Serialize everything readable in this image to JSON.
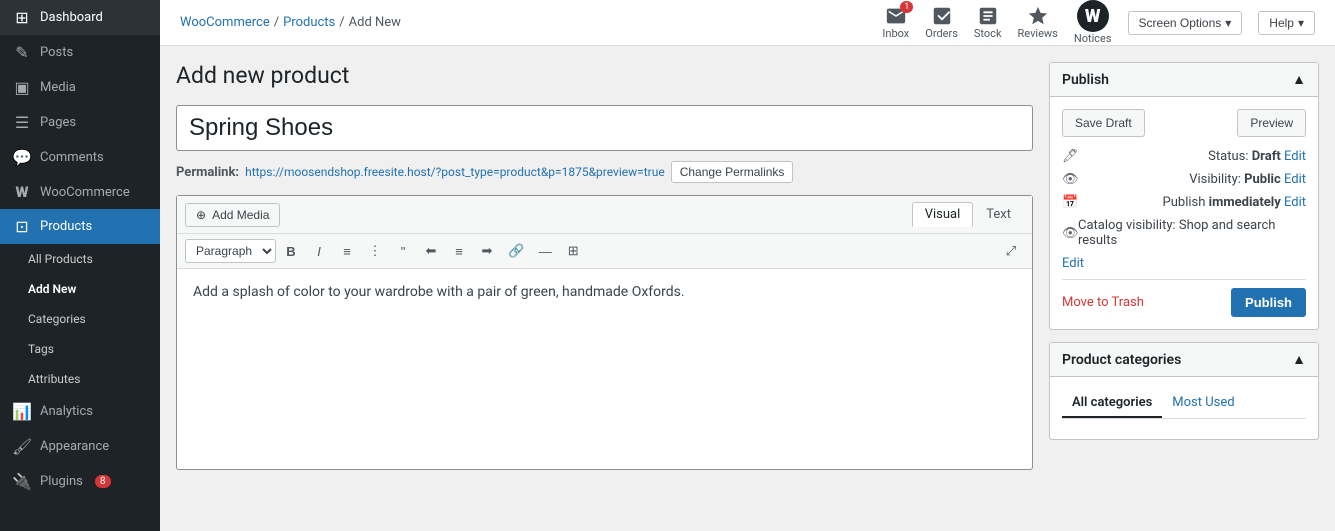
{
  "sidebar": {
    "items": [
      {
        "id": "dashboard",
        "label": "Dashboard",
        "icon": "⊞",
        "active": false
      },
      {
        "id": "posts",
        "label": "Posts",
        "icon": "✎",
        "active": false
      },
      {
        "id": "media",
        "label": "Media",
        "icon": "▣",
        "active": false
      },
      {
        "id": "pages",
        "label": "Pages",
        "icon": "☰",
        "active": false
      },
      {
        "id": "comments",
        "label": "Comments",
        "icon": "💬",
        "active": false
      },
      {
        "id": "woocommerce",
        "label": "WooCommerce",
        "icon": "W",
        "active": false
      },
      {
        "id": "products",
        "label": "Products",
        "icon": "⊡",
        "active": true
      },
      {
        "id": "all-products",
        "label": "All Products",
        "icon": "",
        "active": false,
        "sub": true
      },
      {
        "id": "add-new",
        "label": "Add New",
        "icon": "",
        "active": true,
        "sub": true
      },
      {
        "id": "categories",
        "label": "Categories",
        "icon": "",
        "active": false,
        "sub": true
      },
      {
        "id": "tags",
        "label": "Tags",
        "icon": "",
        "active": false,
        "sub": true
      },
      {
        "id": "attributes",
        "label": "Attributes",
        "icon": "",
        "active": false,
        "sub": true
      },
      {
        "id": "analytics",
        "label": "Analytics",
        "icon": "📊",
        "active": false
      },
      {
        "id": "appearance",
        "label": "Appearance",
        "icon": "🖌",
        "active": false
      },
      {
        "id": "plugins",
        "label": "Plugins",
        "icon": "🔌",
        "active": false,
        "badge": "8"
      }
    ]
  },
  "topbar": {
    "breadcrumb": {
      "woocommerce": "WooCommerce",
      "products": "Products",
      "current": "Add New"
    },
    "icons": [
      {
        "id": "inbox",
        "label": "Inbox",
        "badge": "1"
      },
      {
        "id": "orders",
        "label": "Orders",
        "badge": null
      },
      {
        "id": "stock",
        "label": "Stock",
        "badge": null
      },
      {
        "id": "reviews",
        "label": "Reviews",
        "badge": null
      },
      {
        "id": "notices",
        "label": "Notices",
        "badge": null
      }
    ],
    "screen_options": "Screen Options",
    "help": "Help"
  },
  "page": {
    "title": "Add new product",
    "product_name": "Spring Shoes",
    "permalink_label": "Permalink:",
    "permalink_url": "https://moosendshop.freesite.host/?post_type=product&p=1875&preview=true",
    "change_permalinks": "Change Permalinks",
    "editor": {
      "add_media": "Add Media",
      "tab_visual": "Visual",
      "tab_text": "Text",
      "toolbar_paragraph": "Paragraph",
      "content": "Add a splash of color to your wardrobe with a pair of green, handmade Oxfords."
    }
  },
  "publish_panel": {
    "title": "Publish",
    "save_draft": "Save Draft",
    "preview": "Preview",
    "status_label": "Status:",
    "status_value": "Draft",
    "status_edit": "Edit",
    "visibility_label": "Visibility:",
    "visibility_value": "Public",
    "visibility_edit": "Edit",
    "publish_label": "Publish",
    "publish_type": "immediately",
    "publish_edit": "Edit",
    "catalog_label": "Catalog visibility:",
    "catalog_value": "Shop and search results",
    "catalog_edit": "Edit",
    "move_to_trash": "Move to Trash",
    "publish_btn": "Publish"
  },
  "categories_panel": {
    "title": "Product categories",
    "tab_all": "All categories",
    "tab_most_used": "Most Used"
  }
}
